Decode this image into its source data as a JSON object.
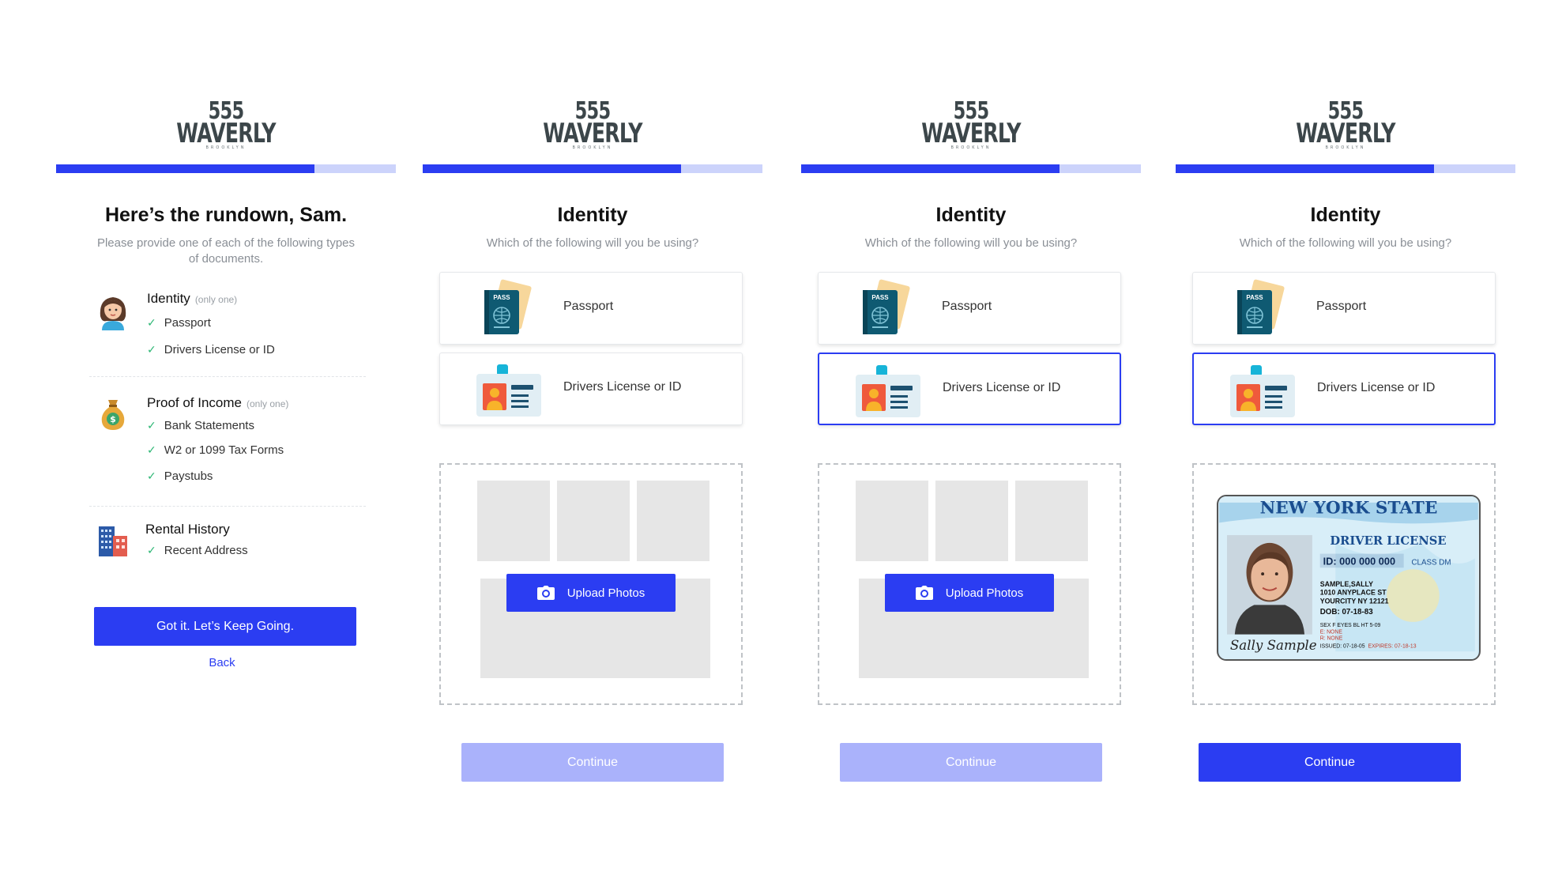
{
  "brand": {
    "number": "555",
    "word": "WAVERLY",
    "sub": "BROOKLYN"
  },
  "progress": [
    0.76,
    0.76,
    0.76,
    0.76
  ],
  "colors": {
    "accent": "#2b3df2",
    "accent_disabled": "#aab2fb",
    "check": "#2bb673",
    "progress_track": "#ccd3fb"
  },
  "rundown": {
    "title": "Here’s the rundown, Sam.",
    "subtitle": "Please provide one of each of the following types of documents.",
    "groups": [
      {
        "icon": "woman-avatar-icon",
        "heading": "Identity",
        "note": "(only one)",
        "items": [
          "Passport",
          "Drivers License or ID"
        ]
      },
      {
        "icon": "money-bag-icon",
        "heading": "Proof of Income",
        "note": "(only one)",
        "items": [
          "Bank Statements",
          "W2 or 1099 Tax Forms",
          "Paystubs"
        ]
      },
      {
        "icon": "building-icon",
        "heading": "Rental History",
        "note": "",
        "items": [
          "Recent Address"
        ]
      }
    ],
    "primary_button": "Got it. Let’s Keep Going.",
    "back_link": "Back"
  },
  "identity": {
    "title": "Identity",
    "subtitle": "Which of the following will you be using?",
    "options": [
      {
        "icon": "passport-icon",
        "label": "Passport",
        "icon_text": "PASS"
      },
      {
        "icon": "id-card-icon",
        "label": "Drivers License or ID"
      }
    ],
    "upload_button": "Upload Photos",
    "continue_button": "Continue"
  },
  "license": {
    "state": "NEW YORK STATE",
    "type": "DRIVER LICENSE",
    "id": "ID: 000 000 000",
    "class": "CLASS DM",
    "name": "SAMPLE,SALLY",
    "address1": "1010 ANYPLACE ST",
    "address2": "YOURCITY NY 12121",
    "dob": "DOB: 07-18-83",
    "details": "SEX F  EYES BL  HT 5-09",
    "e": "E: NONE",
    "r": "R: NONE",
    "issued": "ISSUED: 07-18-05",
    "expires": "EXPIRES: 07-18-13",
    "signature": "Sally Sample"
  }
}
